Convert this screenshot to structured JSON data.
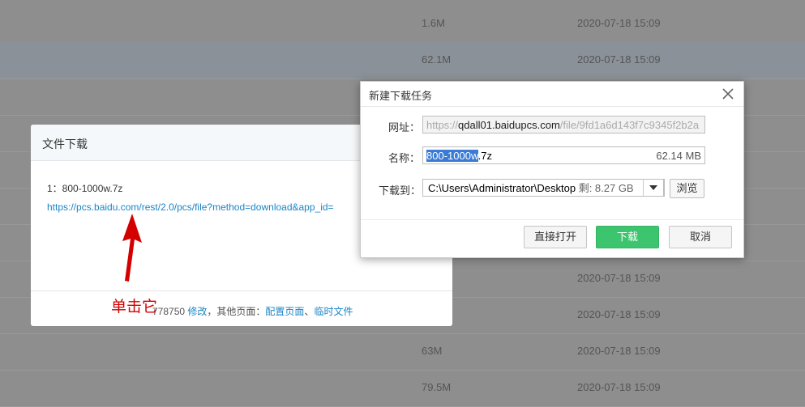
{
  "background": {
    "rows": [
      {
        "size": "1.6M",
        "date": "2020-07-18 15:09"
      },
      {
        "size": "62.1M",
        "date": "2020-07-18 15:09"
      },
      {
        "size": "",
        "date": ""
      },
      {
        "size": "",
        "date": ""
      },
      {
        "size": "",
        "date": ""
      },
      {
        "size": "",
        "date": ""
      },
      {
        "size": "",
        "date": ""
      },
      {
        "size": "",
        "date": "2020-07-18 15:09"
      },
      {
        "size": "",
        "date": "2020-07-18 15:09"
      },
      {
        "size": "63M",
        "date": "2020-07-18 15:09"
      },
      {
        "size": "79.5M",
        "date": "2020-07-18 15:09"
      }
    ]
  },
  "file_dialog": {
    "title": "文件下载",
    "item": "1：800-1000w.7z",
    "link": "https://pcs.baidu.com/rest/2.0/pcs/file?method=download&app_id=",
    "footer": {
      "port_text": "778750",
      "modify": "修改",
      "other_label": "，其他页面：",
      "config_page": "配置页面",
      "separator": "、",
      "temp_files": "临时文件"
    }
  },
  "annotation": "单击它",
  "task_dialog": {
    "title": "新建下载任务",
    "url_label": "网址：",
    "url_prefix": "https://",
    "url_host": "qdall01.baidupcs.com",
    "url_rest": "/file/9fd1a6d143f7c9345f2b2a",
    "name_label": "名称：",
    "name_selected": "800-1000w",
    "name_ext": ".7z",
    "name_size": "62.14 MB",
    "path_label": "下载到：",
    "path_value": "C:\\Users\\Administrator\\Desktop",
    "free_space": "剩: 8.27 GB",
    "browse": "浏览",
    "open_direct": "直接打开",
    "download": "下载",
    "cancel": "取消"
  },
  "colors": {
    "accent_green": "#3cc46e",
    "link_blue": "#1a85c5",
    "annotation_red": "#d40000"
  }
}
